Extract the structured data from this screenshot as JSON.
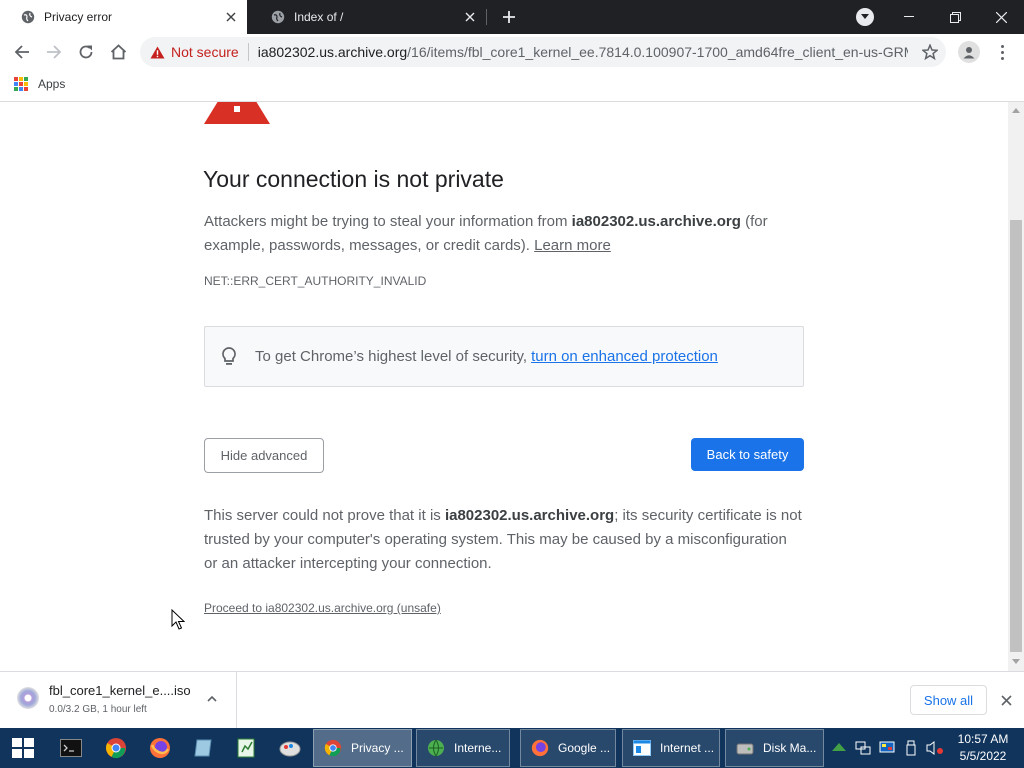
{
  "browser": {
    "tabs": [
      {
        "title": "Privacy error",
        "active": true
      },
      {
        "title": "Index of /",
        "active": false
      }
    ],
    "address": {
      "security_label": "Not secure",
      "host": "ia802302.us.archive.org",
      "path": "/16/items/fbl_core1_kernel_ee.7814.0.100907-1700_amd64fre_client_en-us-GRM..."
    },
    "bookmarks": {
      "apps_label": "Apps"
    }
  },
  "page": {
    "heading": "Your connection is not private",
    "intro_before": "Attackers might be trying to steal your information from ",
    "intro_host": "ia802302.us.archive.org",
    "intro_after": " (for example, passwords, messages, or credit cards). ",
    "learn_more": "Learn more",
    "error_code": "NET::ERR_CERT_AUTHORITY_INVALID",
    "enhanced_text": "To get Chrome’s highest level of security,",
    "enhanced_link": "turn on enhanced protection",
    "hide_advanced": "Hide advanced",
    "back_to_safety": "Back to safety",
    "details_before": "This server could not prove that it is ",
    "details_host": "ia802302.us.archive.org",
    "details_after": "; its security certificate is not trusted by your computer's operating system. This may be caused by a misconfiguration or an attacker intercepting your connection.",
    "proceed": "Proceed to ia802302.us.archive.org (unsafe)"
  },
  "download": {
    "filename": "fbl_core1_kernel_e....iso",
    "status": "0.0/3.2 GB, 1 hour left",
    "show_all": "Show all"
  },
  "taskbar": {
    "buttons": [
      {
        "label": "Privacy ..."
      },
      {
        "label": "Interne..."
      },
      {
        "label": "Google ..."
      },
      {
        "label": "Internet ..."
      },
      {
        "label": "Disk Ma..."
      }
    ],
    "time": "10:57 AM",
    "date": "5/5/2022"
  },
  "colors": {
    "accent": "#1a73e8",
    "danger": "#d93025",
    "taskbar": "#10345c"
  }
}
